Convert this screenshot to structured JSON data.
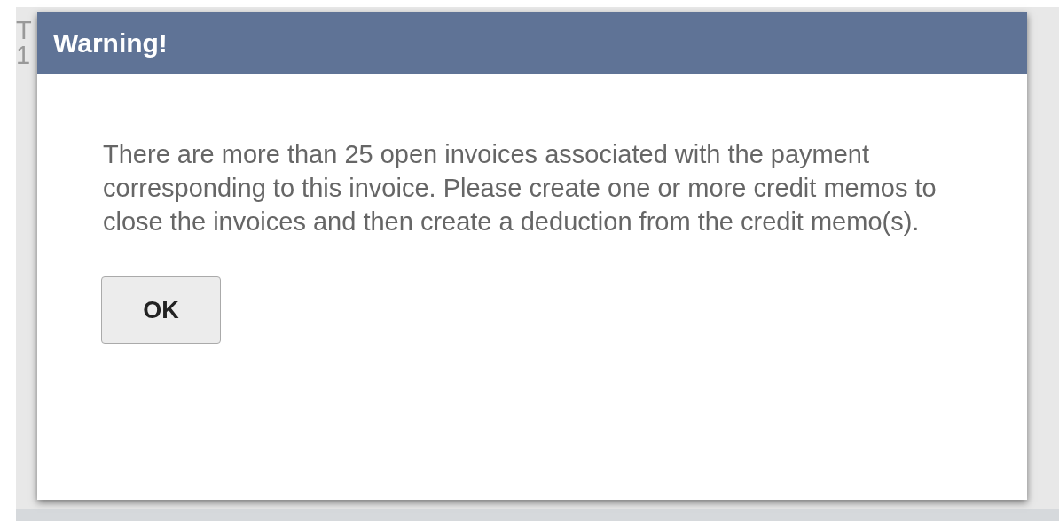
{
  "background_texts": [
    "T",
    "1"
  ],
  "dialog": {
    "title": "Warning!",
    "message": "There are more than 25 open invoices associated with the payment corresponding to this invoice. Please create one or more credit memos to close the invoices and then create a deduction from the credit memo(s).",
    "buttons": [
      "OK"
    ]
  }
}
